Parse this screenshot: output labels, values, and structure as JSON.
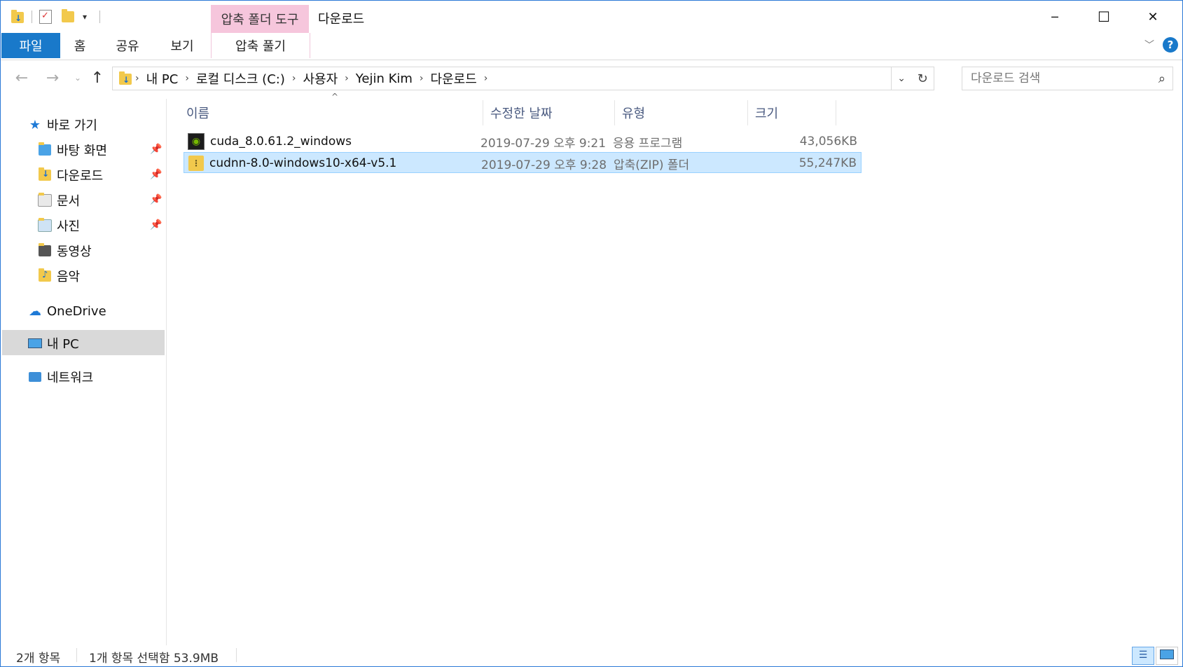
{
  "window": {
    "title": "다운로드",
    "context_tab_group": "압축 폴더 도구",
    "controls": {
      "minimize": "─",
      "maximize": "☐",
      "close": "✕"
    }
  },
  "ribbon": {
    "tabs": [
      {
        "label": "파일"
      },
      {
        "label": "홈"
      },
      {
        "label": "공유"
      },
      {
        "label": "보기"
      },
      {
        "label": "압축 풀기"
      }
    ]
  },
  "address": {
    "crumbs": [
      "내 PC",
      "로컬 디스크 (C:)",
      "사용자",
      "Yejin Kim",
      "다운로드"
    ],
    "search_placeholder": "다운로드 검색"
  },
  "sidebar": {
    "quick_access": "바로 가기",
    "items": [
      {
        "label": "바탕 화면",
        "pinned": true,
        "icon": "desktop-folder-icon"
      },
      {
        "label": "다운로드",
        "pinned": true,
        "icon": "downloads-folder-icon"
      },
      {
        "label": "문서",
        "pinned": true,
        "icon": "documents-folder-icon"
      },
      {
        "label": "사진",
        "pinned": true,
        "icon": "pictures-folder-icon"
      },
      {
        "label": "동영상",
        "pinned": false,
        "icon": "videos-folder-icon"
      },
      {
        "label": "음악",
        "pinned": false,
        "icon": "music-folder-icon"
      }
    ],
    "onedrive": "OneDrive",
    "this_pc": "내 PC",
    "network": "네트워크"
  },
  "columns": {
    "name": "이름",
    "modified": "수정한 날짜",
    "type": "유형",
    "size": "크기"
  },
  "files": [
    {
      "name": "cuda_8.0.61.2_windows",
      "modified": "2019-07-29 오후 9:21",
      "type": "응용 프로그램",
      "size": "43,056KB",
      "icon": "nvidia-app-icon"
    },
    {
      "name": "cudnn-8.0-windows10-x64-v5.1",
      "modified": "2019-07-29 오후 9:28",
      "type": "압축(ZIP) 폴더",
      "size": "55,247KB",
      "icon": "zip-folder-icon"
    }
  ],
  "status": {
    "item_count": "2개 항목",
    "selection": "1개 항목 선택함 53.9MB"
  },
  "colors": {
    "accent": "#1979ca",
    "context_tab": "#f6c6dc",
    "selection": "#cce8ff"
  }
}
